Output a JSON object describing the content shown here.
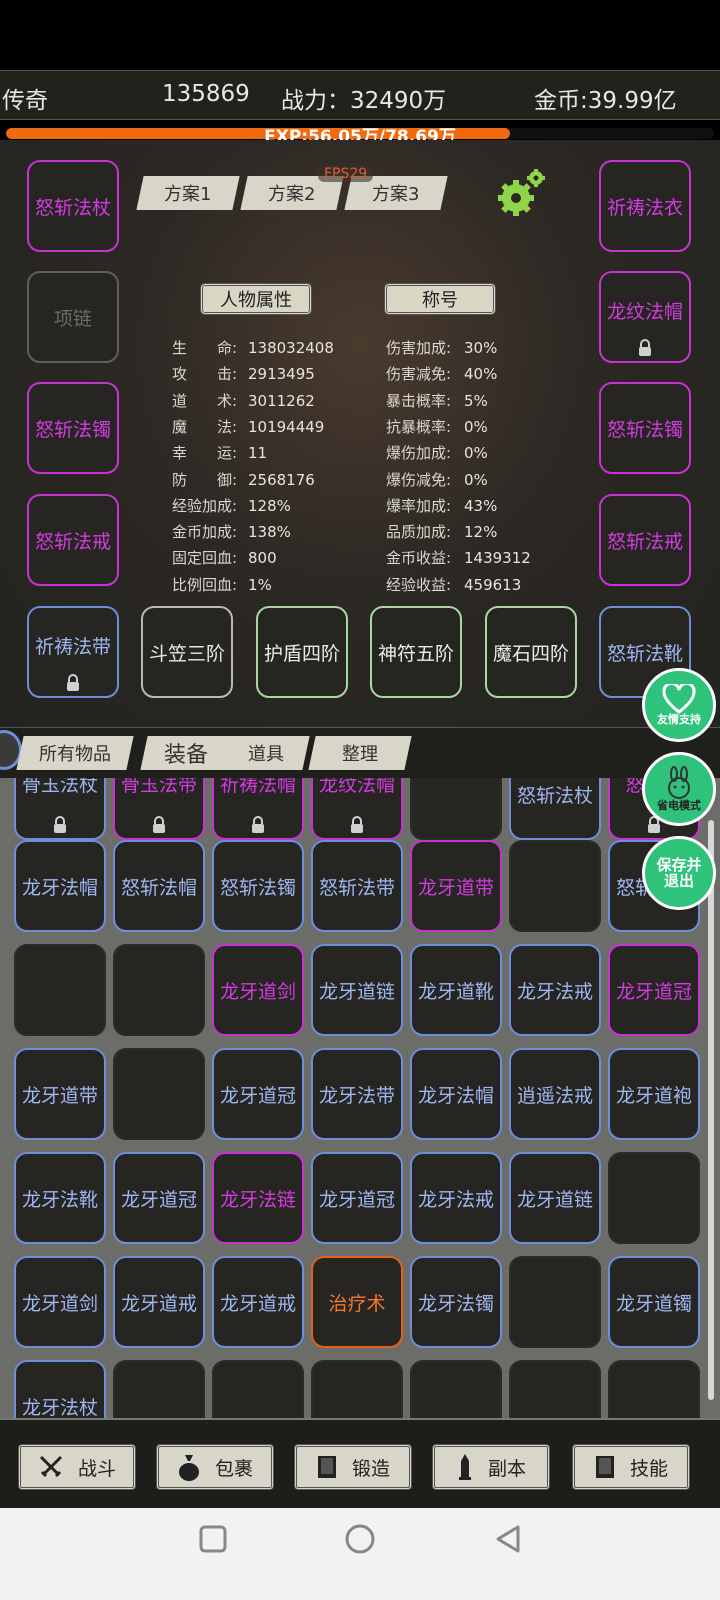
{
  "top": {
    "game_name": "传奇",
    "player_id": "135869",
    "power": "战力：32490万",
    "gold": "金币:39.99亿"
  },
  "exp": {
    "text": "EXP:56.05万/78.69万",
    "progress": 0.7123
  },
  "fps": "FPS29",
  "schemes": [
    "方案1",
    "方案2",
    "方案3"
  ],
  "equip": {
    "weapon": "怒斩法杖",
    "necklace": "项链",
    "bracelet_left": "怒斩法镯",
    "ring_left": "怒斩法戒",
    "armor": "祈祷法衣",
    "helmet": "龙纹法帽",
    "bracelet_right": "怒斩法镯",
    "ring_right": "怒斩法戒",
    "belt": "祈祷法带",
    "hat": "斗笠三阶",
    "shield": "护盾四阶",
    "talisman": "神符五阶",
    "gem": "魔石四阶",
    "boots": "怒斩法靴"
  },
  "attr_buttons": {
    "attributes": "人物属性",
    "title": "称号"
  },
  "stats_left": [
    {
      "k": "生　　命:",
      "v": "138032408"
    },
    {
      "k": "攻　　击:",
      "v": "2913495"
    },
    {
      "k": "道　　术:",
      "v": "3011262"
    },
    {
      "k": "魔　　法:",
      "v": "10194449"
    },
    {
      "k": "幸　　运:",
      "v": "11"
    },
    {
      "k": "防　　御:",
      "v": "2568176"
    },
    {
      "k": "经验加成:",
      "v": "128%"
    },
    {
      "k": "金币加成:",
      "v": "138%"
    },
    {
      "k": "固定回血:",
      "v": "800"
    },
    {
      "k": "比例回血:",
      "v": "1%"
    }
  ],
  "stats_right": [
    {
      "k": "伤害加成:",
      "v": "30%"
    },
    {
      "k": "伤害减免:",
      "v": "40%"
    },
    {
      "k": "暴击概率:",
      "v": "5%"
    },
    {
      "k": "抗暴概率:",
      "v": "0%"
    },
    {
      "k": "爆伤加成:",
      "v": "0%"
    },
    {
      "k": "爆伤减免:",
      "v": "0%"
    },
    {
      "k": "爆率加成:",
      "v": "43%"
    },
    {
      "k": "品质加成:",
      "v": "12%"
    },
    {
      "k": "金币收益:",
      "v": "1439312"
    },
    {
      "k": "经验收益:",
      "v": "459613"
    }
  ],
  "bag_tabs": [
    "所有物品",
    "装备",
    "道具",
    "整理"
  ],
  "bag_rows": [
    [
      "骨玉法杖",
      "骨玉法带",
      "祈祷法帽",
      "龙纹法帽",
      "",
      "怒斩法杖",
      "怒斩法"
    ],
    [
      "龙牙法帽",
      "怒斩法帽",
      "怒斩法镯",
      "怒斩法带",
      "龙牙道带",
      "",
      "怒斩法靴"
    ],
    [
      "",
      "",
      "龙牙道剑",
      "龙牙道链",
      "龙牙道靴",
      "龙牙法戒",
      "龙牙道冠"
    ],
    [
      "龙牙道带",
      "",
      "龙牙道冠",
      "龙牙法带",
      "龙牙法帽",
      "逍遥法戒",
      "龙牙道袍"
    ],
    [
      "龙牙法靴",
      "龙牙道冠",
      "龙牙法链",
      "龙牙道冠",
      "龙牙法戒",
      "龙牙道链",
      ""
    ],
    [
      "龙牙道剑",
      "龙牙道戒",
      "龙牙道戒",
      "治疗术",
      "龙牙法镯",
      "",
      "龙牙道镯"
    ],
    [
      "龙牙法杖",
      "",
      "",
      "",
      "",
      "",
      ""
    ]
  ],
  "fabs": {
    "support": "友情支持",
    "power_save": "省电模式",
    "save_exit": "保存并退出"
  },
  "nav": [
    "战斗",
    "包裹",
    "锻造",
    "副本",
    "技能"
  ],
  "colors": {
    "purple": "#c533d3",
    "blue": "#6e8ed8",
    "orange": "#e0621c",
    "exp": "#f06a10",
    "fab": "#2ec27a"
  }
}
